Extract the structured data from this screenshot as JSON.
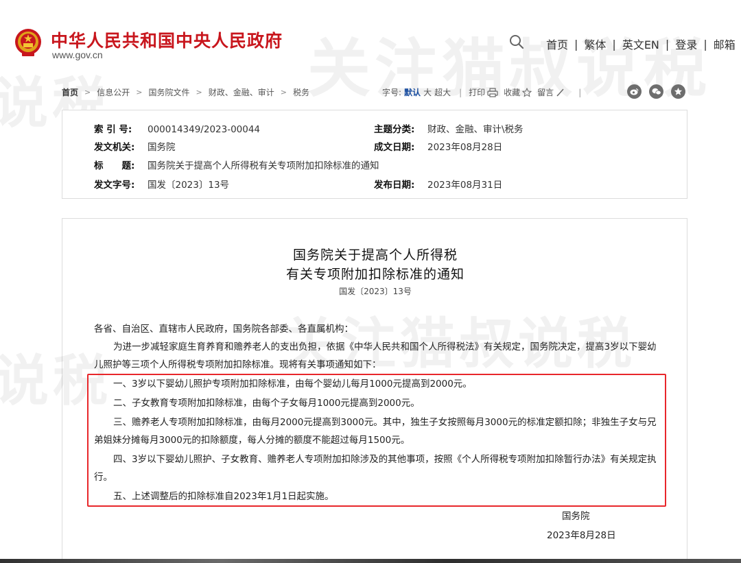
{
  "header": {
    "site_title": "中华人民共和国中央人民政府",
    "site_url": "www.gov.cn",
    "nav": [
      "首页",
      "繁体",
      "英文EN",
      "登录",
      "邮箱"
    ],
    "nav_sep": "|"
  },
  "watermark": {
    "text_a": "关注猫叔说税",
    "text_b": "说税"
  },
  "breadcrumb": {
    "items": [
      "首页",
      "信息公开",
      "国务院文件",
      "财政、金融、审计",
      "税务"
    ],
    "arrow": ">"
  },
  "toolbar": {
    "font_size_label": "字号:",
    "sizes": [
      "默认",
      "大",
      "超大"
    ],
    "print_label": "打印",
    "favorite_label": "收藏",
    "comment_label": "留言",
    "sep": "|"
  },
  "info": {
    "index_no_label": "索 引 号:",
    "index_no": "000014349/2023-00044",
    "topic_label": "主题分类:",
    "topic": "财政、金融、审计\\税务",
    "issuer_label": "发文机关:",
    "issuer": "国务院",
    "created_label": "成文日期:",
    "created": "2023年08月28日",
    "title_label": "标　　题:",
    "title": "国务院关于提高个人所得税有关专项附加扣除标准的通知",
    "doc_no_label": "发文字号:",
    "doc_no": "国发〔2023〕13号",
    "published_label": "发布日期:",
    "published": "2023年08月31日"
  },
  "article": {
    "title_line1": "国务院关于提高个人所得税",
    "title_line2": "有关专项附加扣除标准的通知",
    "doc_no": "国发〔2023〕13号",
    "salutation": "各省、自治区、直辖市人民政府，国务院各部委、各直属机构：",
    "intro": "为进一步减轻家庭生育养育和赡养老人的支出负担，依据《中华人民共和国个人所得税法》有关规定，国务院决定，提高3岁以下婴幼儿照护等三项个人所得税专项附加扣除标准。现将有关事项通知如下：",
    "items": [
      "一、3岁以下婴幼儿照护专项附加扣除标准，由每个婴幼儿每月1000元提高到2000元。",
      "二、子女教育专项附加扣除标准，由每个子女每月1000元提高到2000元。",
      "三、赡养老人专项附加扣除标准，由每月2000元提高到3000元。其中，独生子女按照每月3000元的标准定额扣除；非独生子女与兄弟姐妹分摊每月3000元的扣除额度，每人分摊的额度不能超过每月1500元。",
      "四、3岁以下婴幼儿照护、子女教育、赡养老人专项附加扣除涉及的其他事项，按照《个人所得税专项附加扣除暂行办法》有关规定执行。",
      "五、上述调整后的扣除标准自2023年1月1日起实施。"
    ],
    "signer": "国务院",
    "sign_date": "2023年8月28日"
  },
  "colors": {
    "brand_red": "#c8161d",
    "highlight_border": "#e8262a",
    "active_font_size": "#1a4ea0"
  },
  "icons": [
    "national-emblem-icon",
    "search-icon",
    "print-icon",
    "star-icon",
    "pencil-icon",
    "weibo-icon",
    "wechat-icon",
    "favorite-star-icon"
  ]
}
